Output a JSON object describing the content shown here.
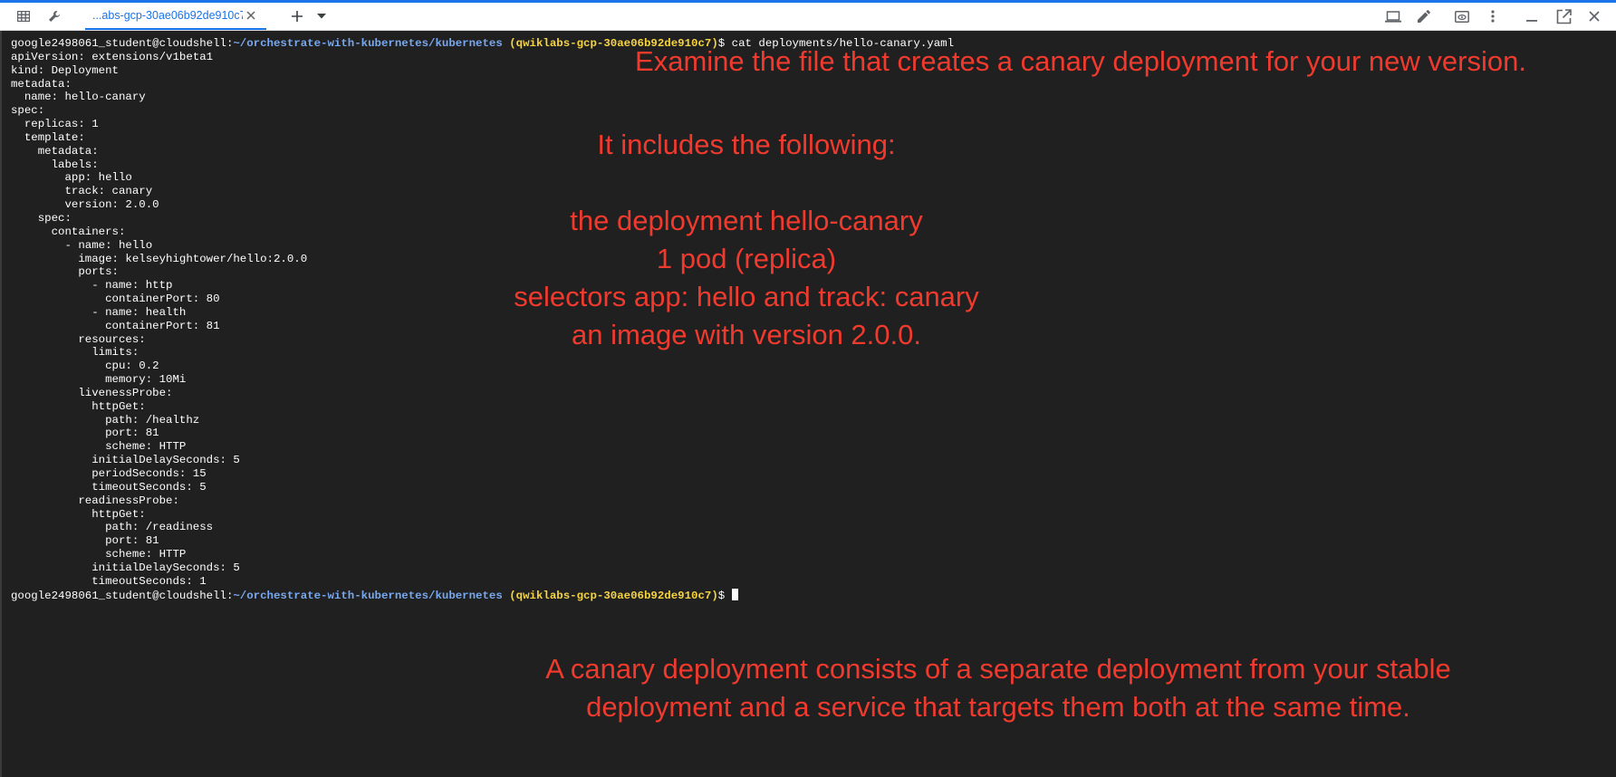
{
  "tab": {
    "title": "...abs-gcp-30ae06b92de910c7)"
  },
  "toolbar": {
    "left_icons": [
      "grid-icon",
      "wrench-icon"
    ],
    "right_icons": [
      "laptop-icon",
      "pencil-icon",
      "preview-icon",
      "more-vert-icon",
      "minimize-icon",
      "open-new-window-icon",
      "close-icon"
    ]
  },
  "terminal": {
    "prompt_user": "google2498061_student@cloudshell:",
    "prompt_path": "~/orchestrate-with-kubernetes/kubernetes",
    "prompt_project": "(qwiklabs-gcp-30ae06b92de910c7)",
    "prompt_symbol": "$ ",
    "command": "cat deployments/hello-canary.yaml",
    "output": [
      "apiVersion: extensions/v1beta1",
      "kind: Deployment",
      "metadata:",
      "  name: hello-canary",
      "spec:",
      "  replicas: 1",
      "  template:",
      "    metadata:",
      "      labels:",
      "        app: hello",
      "        track: canary",
      "        version: 2.0.0",
      "    spec:",
      "      containers:",
      "        - name: hello",
      "          image: kelseyhightower/hello:2.0.0",
      "          ports:",
      "            - name: http",
      "              containerPort: 80",
      "            - name: health",
      "              containerPort: 81",
      "          resources:",
      "            limits:",
      "              cpu: 0.2",
      "              memory: 10Mi",
      "          livenessProbe:",
      "            httpGet:",
      "              path: /healthz",
      "              port: 81",
      "              scheme: HTTP",
      "            initialDelaySeconds: 5",
      "            periodSeconds: 15",
      "            timeoutSeconds: 5",
      "          readinessProbe:",
      "            httpGet:",
      "              path: /readiness",
      "              port: 81",
      "              scheme: HTTP",
      "            initialDelaySeconds: 5",
      "            timeoutSeconds: 1"
    ]
  },
  "annotations": {
    "examine": "Examine the file that creates a canary deployment for your new version.",
    "includes": [
      "It includes the following:",
      "",
      "the deployment hello-canary",
      "1 pod (replica)",
      "selectors app: hello and track: canary",
      "an image with version 2.0.0."
    ],
    "canary_note": [
      "A canary deployment consists of a separate deployment from your stable",
      "deployment and a service that targets them both at the same time."
    ]
  },
  "colors": {
    "accent": "#1a73e8",
    "terminal_bg": "#202020",
    "terminal_text": "#ffffff",
    "prompt_path": "#78a9f0",
    "prompt_project": "#f6d440",
    "annotation": "#f03a2e"
  }
}
